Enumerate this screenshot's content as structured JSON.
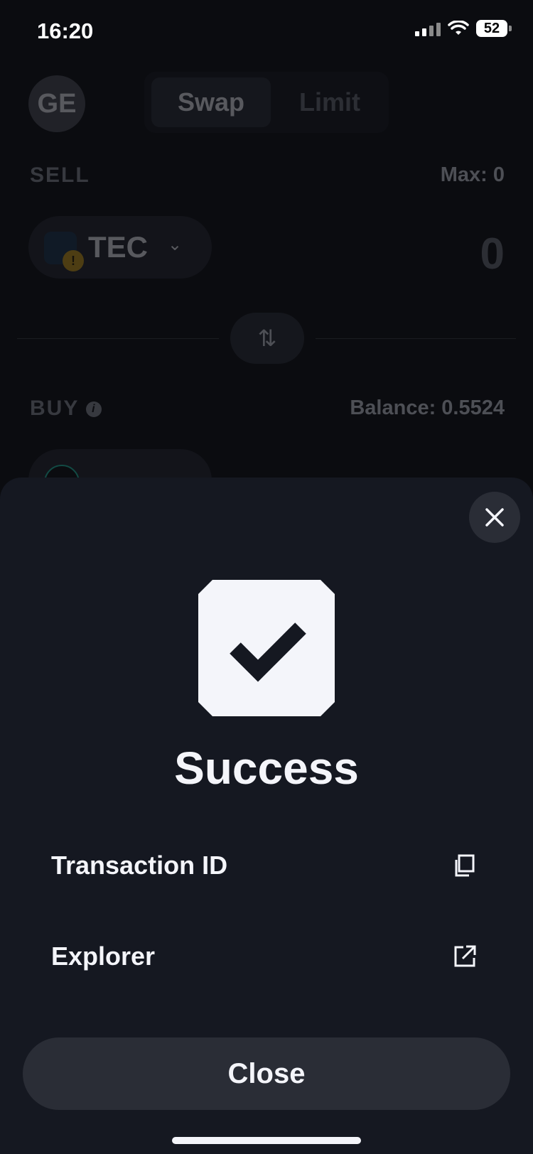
{
  "status_bar": {
    "time": "16:20",
    "battery": "52"
  },
  "swap": {
    "avatar_initials": "GE",
    "tabs": [
      {
        "label": "Swap",
        "active": true
      },
      {
        "label": "Limit",
        "active": false
      }
    ],
    "sell": {
      "label": "SELL",
      "max_text": "Max: 0",
      "token": "TEC",
      "amount": "0"
    },
    "buy": {
      "label": "BUY",
      "balance_text": "Balance: 0.5524"
    }
  },
  "sheet": {
    "title": "Success",
    "rows": [
      {
        "label": "Transaction ID",
        "icon": "copy-icon"
      },
      {
        "label": "Explorer",
        "icon": "external-link-icon"
      }
    ],
    "close_label": "Close"
  },
  "colors": {
    "background": "#0b0c10",
    "sheet": "#151821",
    "button": "#2a2d36",
    "text": "#f4f5fa"
  }
}
